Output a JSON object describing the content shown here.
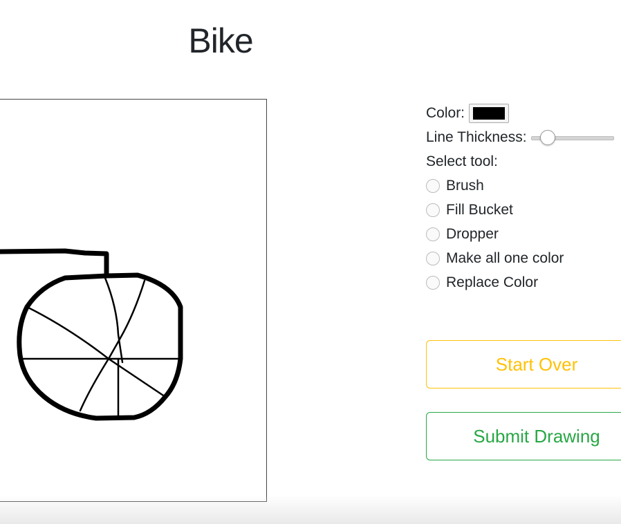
{
  "page": {
    "title": "Bike"
  },
  "drawing": {
    "stroke_color": "#000000",
    "background_color": "#ffffff"
  },
  "controls": {
    "color_label": "Color:",
    "color_value": "#000000",
    "thickness_label": "Line Thickness:",
    "thickness_fraction": 0.12,
    "select_tool_label": "Select tool:",
    "tools": [
      {
        "label": "Brush",
        "selected": false
      },
      {
        "label": "Fill Bucket",
        "selected": false
      },
      {
        "label": "Dropper",
        "selected": false
      },
      {
        "label": "Make all one color",
        "selected": false
      },
      {
        "label": "Replace Color",
        "selected": false
      }
    ]
  },
  "buttons": {
    "start_over": "Start Over",
    "submit_drawing": "Submit Drawing"
  },
  "colors": {
    "warning": "#ffc107",
    "success": "#28a745"
  }
}
